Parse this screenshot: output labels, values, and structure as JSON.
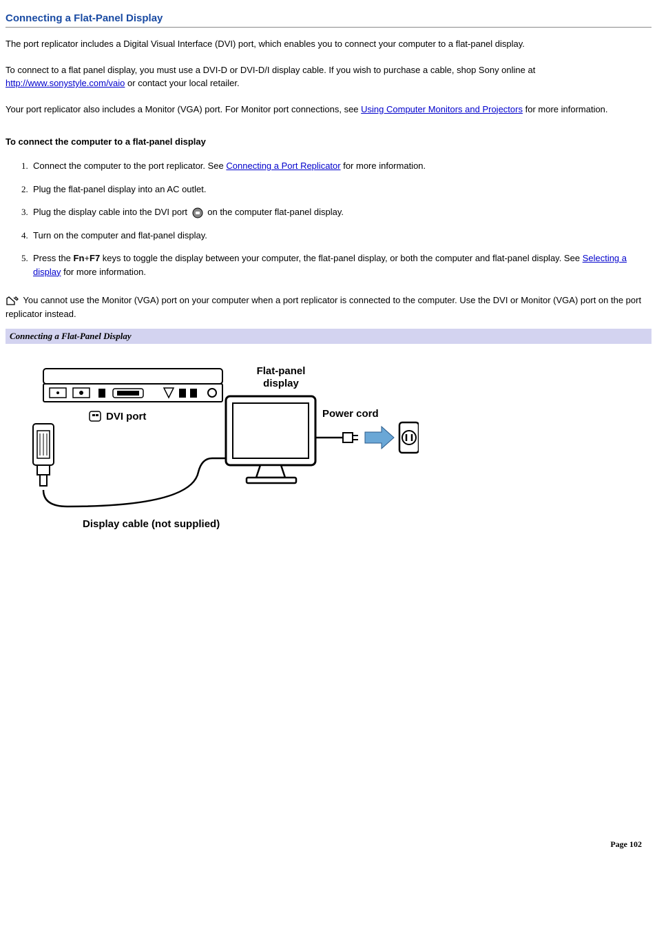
{
  "title": "Connecting a Flat-Panel Display",
  "para1": "The port replicator includes a Digital Visual Interface (DVI) port, which enables you to connect your computer to a flat-panel display.",
  "para2_a": "To connect to a flat panel display, you must use a DVI-D or DVI-D/I display cable. If you wish to purchase a cable, shop Sony online at ",
  "para2_link": "http://www.sonystyle.com/vaio",
  "para2_b": " or contact your local retailer.",
  "para3_a": "Your port replicator also includes a Monitor (VGA) port. For Monitor port connections, see ",
  "para3_link": "Using Computer Monitors and Projectors",
  "para3_b": " for more information.",
  "sub_heading": "To connect the computer to a flat-panel display",
  "steps": {
    "s1_a": "Connect the computer to the port replicator. See ",
    "s1_link": "Connecting a Port Replicator",
    "s1_b": " for more information.",
    "s2": "Plug the flat-panel display into an AC outlet.",
    "s3_a": "Plug the display cable into the DVI port  ",
    "s3_b": " on the computer flat-panel display.",
    "s4": "Turn on the computer and flat-panel display.",
    "s5_a": "Press the ",
    "s5_fn": "Fn",
    "s5_plus": "+",
    "s5_f7": "F7",
    "s5_b": " keys to toggle the display between your computer, the flat-panel display, or both the computer and flat-panel display. See ",
    "s5_link": "Selecting a display",
    "s5_c": " for more information."
  },
  "note": " You cannot use the Monitor (VGA) port on your computer when a port replicator is connected to the computer. Use the DVI or Monitor (VGA) port on the port replicator instead.",
  "figure_caption": "Connecting a Flat-Panel Display",
  "diagram": {
    "flat_panel_display": "Flat-panel display",
    "dvi_port": "DVI port",
    "power_cord": "Power cord",
    "display_cable": "Display cable (not supplied)"
  },
  "page_number": "Page 102"
}
